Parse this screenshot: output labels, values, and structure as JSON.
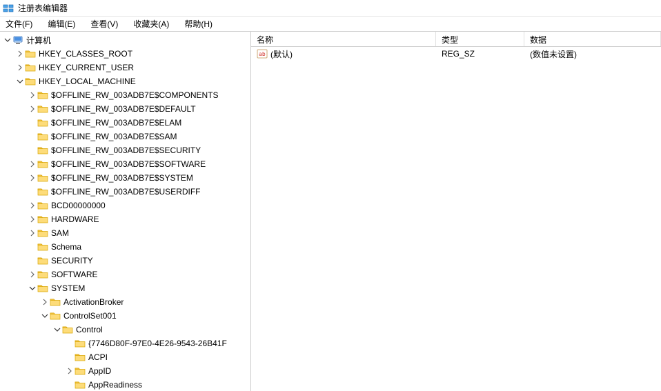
{
  "title": "注册表编辑器",
  "menubar": {
    "file": "文件(F)",
    "edit": "编辑(E)",
    "view": "查看(V)",
    "favorites": "收藏夹(A)",
    "help": "帮助(H)"
  },
  "tree": {
    "root": "计算机",
    "hkcr": "HKEY_CLASSES_ROOT",
    "hkcu": "HKEY_CURRENT_USER",
    "hklm": "HKEY_LOCAL_MACHINE",
    "hklm_children": {
      "offline_components": "$OFFLINE_RW_003ADB7E$COMPONENTS",
      "offline_default": "$OFFLINE_RW_003ADB7E$DEFAULT",
      "offline_elam": "$OFFLINE_RW_003ADB7E$ELAM",
      "offline_sam": "$OFFLINE_RW_003ADB7E$SAM",
      "offline_security": "$OFFLINE_RW_003ADB7E$SECURITY",
      "offline_software": "$OFFLINE_RW_003ADB7E$SOFTWARE",
      "offline_system": "$OFFLINE_RW_003ADB7E$SYSTEM",
      "offline_userdiff": "$OFFLINE_RW_003ADB7E$USERDIFF",
      "bcd": "BCD00000000",
      "hardware": "HARDWARE",
      "sam": "SAM",
      "schema": "Schema",
      "security": "SECURITY",
      "software": "SOFTWARE",
      "system": "SYSTEM"
    },
    "system_children": {
      "activationbroker": "ActivationBroker",
      "controlset001": "ControlSet001"
    },
    "controlset_children": {
      "control": "Control"
    },
    "control_children": {
      "guid": "{7746D80F-97E0-4E26-9543-26B41F",
      "acpi": "ACPI",
      "appid": "AppID",
      "appreadiness": "AppReadiness"
    }
  },
  "columns": {
    "name": "名称",
    "type": "类型",
    "data": "数据"
  },
  "values": [
    {
      "name": "(默认)",
      "type": "REG_SZ",
      "data": "(数值未设置)"
    }
  ]
}
